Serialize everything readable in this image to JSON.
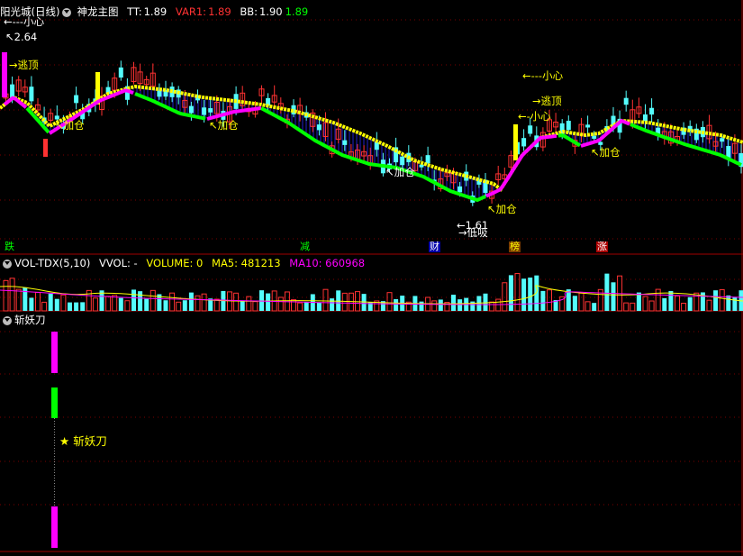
{
  "main_panel": {
    "stock_name": "阳光城(日线)",
    "indicator": "神龙主图",
    "tt_label": "TT:",
    "tt_value": "1.89",
    "var1_label": "VAR1:",
    "var1_value": "1.89",
    "bb_label": "BB:",
    "bb_value": "1.90",
    "bb_extra": "1.89",
    "price_high": "2.64",
    "price_low": "1.61",
    "annotations": {
      "small_heart_top": "小心",
      "escape_top_1": "逃顶",
      "add_pos_1": "加仓",
      "add_pos_2": "加仓",
      "add_pos_3": "加仓",
      "add_pos_4": "加仓",
      "add_pos_5": "加仓",
      "low_buy": "低吸",
      "small_heart_2": "小心",
      "escape_top_2": "逃顶",
      "small_heart_3": "小心"
    },
    "bottom_marks": [
      "跌",
      "减",
      "财",
      "榜",
      "涨"
    ]
  },
  "volume_panel": {
    "title": "VOL-TDX(5,10)",
    "vvol": "VVOL: -",
    "volume": "VOLUME: 0",
    "ma5": "MA5: 481213",
    "ma10": "MA10: 660968"
  },
  "signal_panel": {
    "title": "斩妖刀",
    "signal_label": "斩妖刀",
    "star": "★"
  },
  "colors": {
    "background": "#000000",
    "up": "#ff3232",
    "down": "#54fcfc",
    "yellow": "#ffff00",
    "magenta": "#ff00ff",
    "green": "#00ff00",
    "grid": "#7a0000"
  }
}
